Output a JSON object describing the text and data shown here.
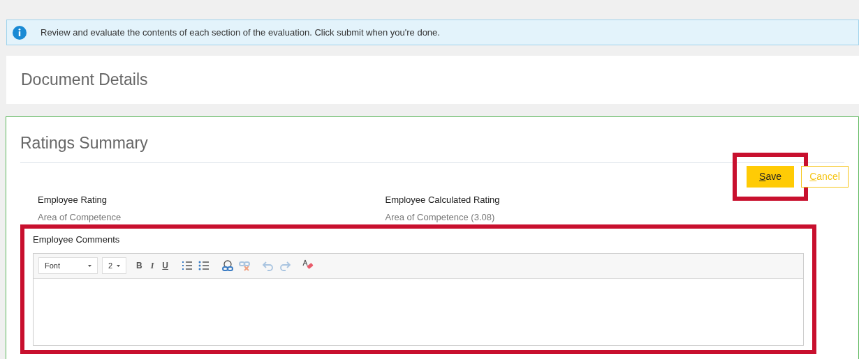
{
  "notice": {
    "text": "Review and evaluate the contents of each section of the evaluation. Click submit when you're done."
  },
  "sections": [
    {
      "title": "Document Details",
      "active": false
    },
    {
      "title": "Ratings Summary",
      "active": true
    }
  ],
  "buttons": [
    {
      "label": "Save",
      "kind": "primary",
      "highlighted": true
    },
    {
      "label": "Cancel",
      "kind": "secondary",
      "highlighted": false
    }
  ],
  "ratings": [
    {
      "label": "Employee Rating",
      "value": "Area of Competence"
    },
    {
      "label": "Employee Calculated Rating",
      "value": "Area of Competence (3.08)"
    }
  ],
  "comments": {
    "label": "Employee Comments",
    "highlighted": true,
    "selects": [
      "Font",
      "2"
    ],
    "format_buttons": [
      {
        "label": "B",
        "kind": "bold"
      },
      {
        "label": "I",
        "kind": "italic"
      },
      {
        "label": "U",
        "kind": "underline"
      }
    ],
    "tools": [
      {
        "disabled": false
      },
      {
        "disabled": false
      },
      {
        "disabled": false
      },
      {
        "disabled": true
      },
      {
        "disabled": true
      },
      {
        "disabled": true
      },
      {
        "disabled": false
      }
    ]
  }
}
